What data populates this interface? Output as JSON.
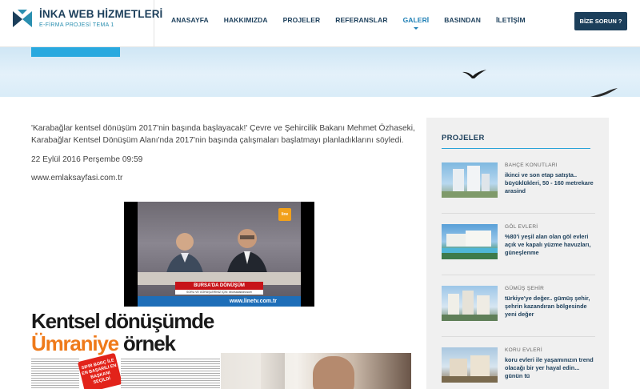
{
  "header": {
    "logo_title": "İNKA WEB HİZMETLERİ",
    "logo_subtitle": "E-FİRMA PROJESİ TEMA 1",
    "nav": [
      {
        "label": "ANASAYFA"
      },
      {
        "label": "HAKKIMIZDA"
      },
      {
        "label": "PROJELER"
      },
      {
        "label": "REFERANSLAR"
      },
      {
        "label": "GALERİ"
      },
      {
        "label": "BASINDAN"
      },
      {
        "label": "İLETİŞİM"
      }
    ],
    "cta_label": "BİZE SORUN ?"
  },
  "article": {
    "paragraph": "'Karabağlar kentsel dönüşüm 2017'nin başında başlayacak!' Çevre ve Şehircilik Bakanı Mehmet Özhaseki, Karabağlar Kentsel Dönüşüm Alanı'nda 2017'nin başında çalışmaları başlatmayı planladıklarını söyledi.",
    "date": "22 Eylül 2016 Perşembe 09:59",
    "source": "www.emlaksayfasi.com.tr",
    "video": {
      "lower_third": "BURSA'DA DÖNÜŞÜM",
      "lower_sub": "SORU VE GÖRÜŞLERİNİZ İÇİN: #bursadadonusum",
      "ticker": "www.linetv.com.tr",
      "channel_logo": "line"
    },
    "newspaper": {
      "headline_line1": "Kentsel dönüşümde",
      "headline_word_highlight": "Ümraniye",
      "headline_word_rest": " örnek",
      "badge": "SIFIR BORÇ İLE EN BAŞARILI EN BAŞKANI SEÇİLDİ"
    }
  },
  "sidebar": {
    "title": "PROJELER",
    "projects": [
      {
        "category": "BAHÇE KONUTLARI",
        "description": "ikinci ve son etap satışta.. büyüklükleri, 50 - 160 metrekare arasind"
      },
      {
        "category": "GÖL EVLERİ",
        "description": "%80'i yeşil alan olan göl evleri açık ve kapalı yüzme havuzları, güneşlenme"
      },
      {
        "category": "GÜMÜŞ ŞEHİR",
        "description": "türkiye'ye değer.. gümüş şehir, şehrin kazandıran bölgesinde yeni değer"
      },
      {
        "category": "KORU EVLERİ",
        "description": "koru evleri ile yaşamınızın trend olacağı bir yer hayal edin... günün tü"
      }
    ]
  },
  "colors": {
    "brand_navy": "#1c3f5b",
    "accent_blue": "#29a9df",
    "highlight_orange": "#ef7a1a"
  }
}
